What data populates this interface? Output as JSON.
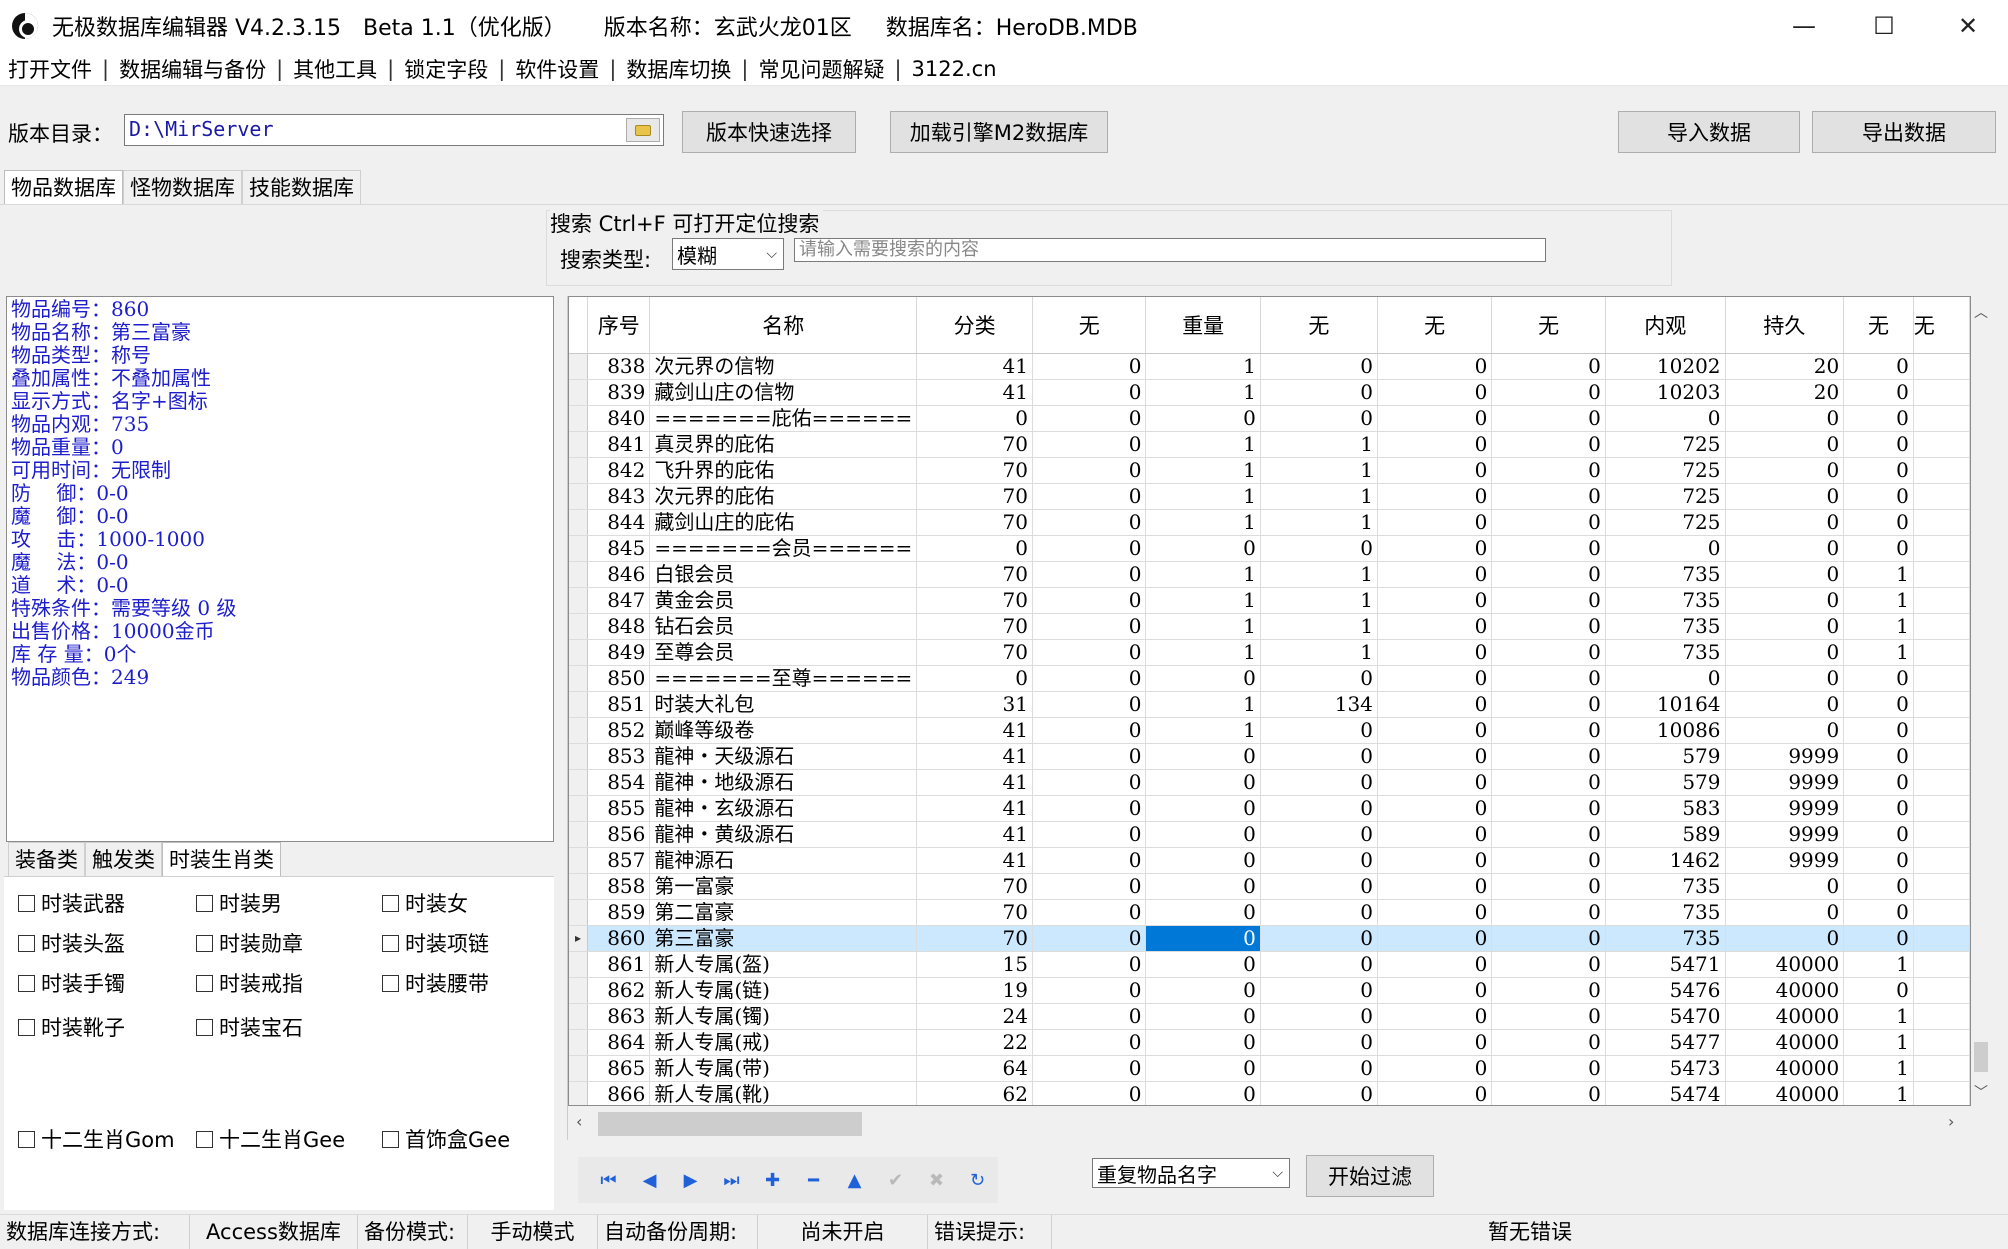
{
  "window": {
    "title_app": "无极数据库编辑器 V4.2.3.15",
    "title_beta": "Beta 1.1（优化版）",
    "title_version": "版本名称：玄武火龙01区",
    "title_db": "数据库名：HeroDB.MDB",
    "minimize": "—",
    "maximize": "☐",
    "close": "✕"
  },
  "menu": {
    "items": [
      "打开文件",
      "数据编辑与备份",
      "其他工具",
      "锁定字段",
      "软件设置",
      "数据库切换",
      "常见问题解疑",
      "3122.cn"
    ],
    "sep": "|"
  },
  "toolbar": {
    "dir_label": "版本目录：",
    "dir_value": "D:\\MirServer",
    "quick_select": "版本快速选择",
    "load_m2": "加载引擎M2数据库",
    "import": "导入数据",
    "export": "导出数据"
  },
  "tabs": [
    "物品数据库",
    "怪物数据库",
    "技能数据库"
  ],
  "search": {
    "title": "搜索  Ctrl+F 可打开定位搜索",
    "type_label": "搜索类型:",
    "type_value": "模糊",
    "placeholder": "请输入需要搜索的内容"
  },
  "info": [
    "物品编号：860",
    "物品名称：第三富豪",
    "物品类型：称号",
    "叠加属性：不叠加属性",
    "显示方式：名字+图标",
    "物品内观：735",
    "物品重量：0",
    "可用时间：无限制",
    "防    御：0-0",
    "魔    御：0-0",
    "攻    击：1000-1000",
    "魔    法：0-0",
    "道    术：0-0",
    "特殊条件：需要等级 0 级",
    "出售价格：10000金币",
    "库 存 量：0个",
    "物品颜色：249"
  ],
  "subtabs": [
    "装备类",
    "触发类",
    "时装生肖类"
  ],
  "checkboxes": [
    [
      "时装武器",
      "时装男",
      "时装女"
    ],
    [
      "时装头盔",
      "时装勋章",
      "时装项链"
    ],
    [
      "时装手镯",
      "时装戒指",
      "时装腰带"
    ],
    [
      "时装靴子",
      "时装宝石",
      ""
    ],
    [
      "十二生肖Gom",
      "十二生肖Gee",
      "首饰盒Gee"
    ]
  ],
  "grid": {
    "columns": [
      "序号",
      "名称",
      "分类",
      "无",
      "重量",
      "无",
      "无",
      "无",
      "内观",
      "持久",
      "无",
      "无"
    ],
    "selected_index": 22,
    "rows": [
      [
        "838",
        "次元界の信物",
        "41",
        "0",
        "1",
        "0",
        "0",
        "0",
        "10202",
        "20",
        "0"
      ],
      [
        "839",
        "藏剑山庄の信物",
        "41",
        "0",
        "1",
        "0",
        "0",
        "0",
        "10203",
        "20",
        "0"
      ],
      [
        "840",
        "=======庇佑======",
        "0",
        "0",
        "0",
        "0",
        "0",
        "0",
        "0",
        "0",
        "0"
      ],
      [
        "841",
        "真灵界的庇佑",
        "70",
        "0",
        "1",
        "1",
        "0",
        "0",
        "725",
        "0",
        "0"
      ],
      [
        "842",
        "飞升界的庇佑",
        "70",
        "0",
        "1",
        "1",
        "0",
        "0",
        "725",
        "0",
        "0"
      ],
      [
        "843",
        "次元界的庇佑",
        "70",
        "0",
        "1",
        "1",
        "0",
        "0",
        "725",
        "0",
        "0"
      ],
      [
        "844",
        "藏剑山庄的庇佑",
        "70",
        "0",
        "1",
        "1",
        "0",
        "0",
        "725",
        "0",
        "0"
      ],
      [
        "845",
        "=======会员======",
        "0",
        "0",
        "0",
        "0",
        "0",
        "0",
        "0",
        "0",
        "0"
      ],
      [
        "846",
        "白银会员",
        "70",
        "0",
        "1",
        "1",
        "0",
        "0",
        "735",
        "0",
        "1"
      ],
      [
        "847",
        "黄金会员",
        "70",
        "0",
        "1",
        "1",
        "0",
        "0",
        "735",
        "0",
        "1"
      ],
      [
        "848",
        "钻石会员",
        "70",
        "0",
        "1",
        "1",
        "0",
        "0",
        "735",
        "0",
        "1"
      ],
      [
        "849",
        "至尊会员",
        "70",
        "0",
        "1",
        "1",
        "0",
        "0",
        "735",
        "0",
        "1"
      ],
      [
        "850",
        "=======至尊======",
        "0",
        "0",
        "0",
        "0",
        "0",
        "0",
        "0",
        "0",
        "0"
      ],
      [
        "851",
        "时装大礼包",
        "31",
        "0",
        "1",
        "134",
        "0",
        "0",
        "10164",
        "0",
        "0"
      ],
      [
        "852",
        "巅峰等级卷",
        "41",
        "0",
        "1",
        "0",
        "0",
        "0",
        "10086",
        "0",
        "0"
      ],
      [
        "853",
        "龍神・天级源石",
        "41",
        "0",
        "0",
        "0",
        "0",
        "0",
        "579",
        "9999",
        "0"
      ],
      [
        "854",
        "龍神・地级源石",
        "41",
        "0",
        "0",
        "0",
        "0",
        "0",
        "579",
        "9999",
        "0"
      ],
      [
        "855",
        "龍神・玄级源石",
        "41",
        "0",
        "0",
        "0",
        "0",
        "0",
        "583",
        "9999",
        "0"
      ],
      [
        "856",
        "龍神・黄级源石",
        "41",
        "0",
        "0",
        "0",
        "0",
        "0",
        "589",
        "9999",
        "0"
      ],
      [
        "857",
        "龍神源石",
        "41",
        "0",
        "0",
        "0",
        "0",
        "0",
        "1462",
        "9999",
        "0"
      ],
      [
        "858",
        "第一富豪",
        "70",
        "0",
        "0",
        "0",
        "0",
        "0",
        "735",
        "0",
        "0"
      ],
      [
        "859",
        "第二富豪",
        "70",
        "0",
        "0",
        "0",
        "0",
        "0",
        "735",
        "0",
        "0"
      ],
      [
        "860",
        "第三富豪",
        "70",
        "0",
        "0",
        "0",
        "0",
        "0",
        "735",
        "0",
        "0"
      ],
      [
        "861",
        "新人专属(盔)",
        "15",
        "0",
        "0",
        "0",
        "0",
        "0",
        "5471",
        "40000",
        "1"
      ],
      [
        "862",
        "新人专属(链)",
        "19",
        "0",
        "0",
        "0",
        "0",
        "0",
        "5476",
        "40000",
        "0"
      ],
      [
        "863",
        "新人专属(镯)",
        "24",
        "0",
        "0",
        "0",
        "0",
        "0",
        "5470",
        "40000",
        "1"
      ],
      [
        "864",
        "新人专属(戒)",
        "22",
        "0",
        "0",
        "0",
        "0",
        "0",
        "5477",
        "40000",
        "1"
      ],
      [
        "865",
        "新人专属(带)",
        "64",
        "0",
        "0",
        "0",
        "0",
        "0",
        "5473",
        "40000",
        "1"
      ],
      [
        "866",
        "新人专属(靴)",
        "62",
        "0",
        "0",
        "0",
        "0",
        "0",
        "5474",
        "40000",
        "1"
      ]
    ]
  },
  "nav": {
    "first": "first-record-icon",
    "prev": "prev-record-icon",
    "next": "next-record-icon",
    "last": "last-record-icon",
    "add": "add-record-icon",
    "delete": "delete-record-icon",
    "edit": "edit-record-icon",
    "post": "post-record-icon",
    "cancel": "cancel-record-icon",
    "refresh": "refresh-icon"
  },
  "filter": {
    "select_value": "重复物品名字",
    "button": "开始过滤"
  },
  "status": {
    "conn_label": "数据库连接方式:",
    "conn_value": "Access数据库",
    "backup_label": "备份模式:",
    "backup_value": "手动模式",
    "auto_label": "自动备份周期:",
    "auto_value": "尚未开启",
    "err_label": "错误提示:",
    "err_value": "暂无错误"
  },
  "colors": {
    "info_text": "#1d1dcc",
    "selected_row": "#cce8ff",
    "focus_cell": "#0078d7",
    "nav_icon": "#2060d8"
  }
}
